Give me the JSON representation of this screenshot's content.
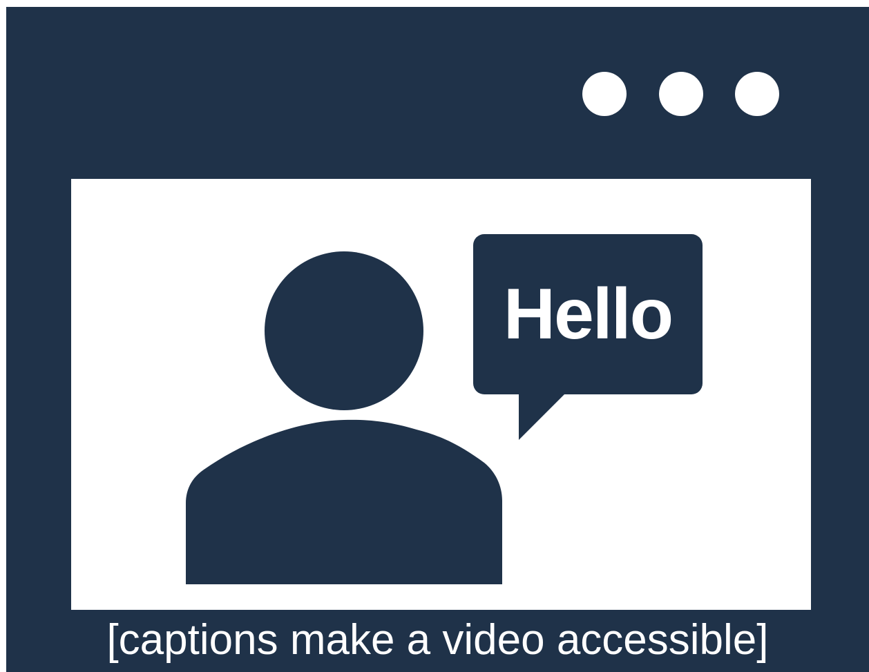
{
  "window": {
    "controls": [
      "dot-icon",
      "dot-icon",
      "dot-icon"
    ],
    "colors": {
      "frame": "#1f3249",
      "screen": "#ffffff",
      "accent": "#ffffff"
    }
  },
  "video": {
    "speaker_icon": "person-icon",
    "speech_bubble": {
      "text": "Hello"
    }
  },
  "caption": {
    "text": "[captions make a video accessible]"
  }
}
